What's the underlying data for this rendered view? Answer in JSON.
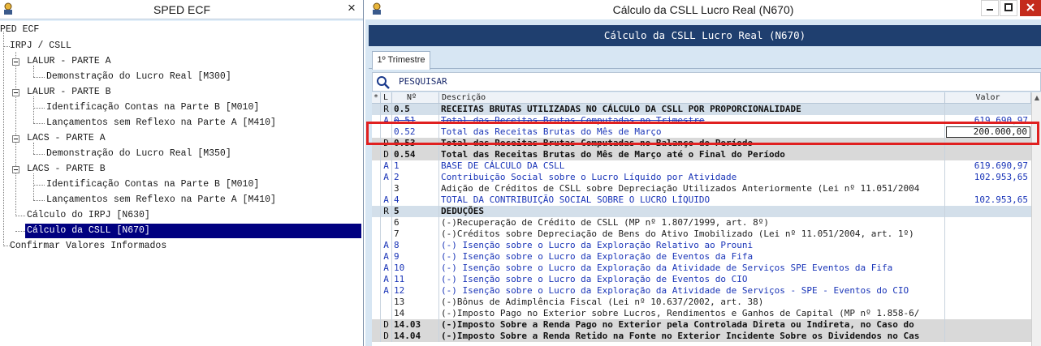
{
  "left_window": {
    "title": "SPED ECF",
    "close_label": "×",
    "tree": [
      {
        "label": "PED ECF"
      },
      {
        "label": "IRPJ / CSLL"
      },
      {
        "label": "LALUR - PARTE A"
      },
      {
        "label": "Demonstração do Lucro Real [M300]"
      },
      {
        "label": "LALUR - PARTE B"
      },
      {
        "label": "Identificação Contas na Parte B [M010]"
      },
      {
        "label": "Lançamentos sem Reflexo na Parte A [M410]"
      },
      {
        "label": "LACS - PARTE A"
      },
      {
        "label": "Demonstração do Lucro Real [M350]"
      },
      {
        "label": "LACS - PARTE B"
      },
      {
        "label": "Identificação Contas na Parte B [M010]"
      },
      {
        "label": "Lançamentos sem Reflexo na Parte A [M410]"
      },
      {
        "label": "Cálculo do IRPJ [N630]"
      },
      {
        "label": "Cálculo da CSLL [N670]"
      },
      {
        "label": "Confirmar Valores Informados"
      }
    ]
  },
  "right_window": {
    "title": "Cálculo da CSLL Lucro Real (N670)",
    "header": "Cálculo da CSLL Lucro Real (N670)",
    "tab": "1º Trimestre",
    "search_label": "PESQUISAR",
    "columns": {
      "mark": "*",
      "l": "L",
      "num": "Nº",
      "desc": "Descrição",
      "val": "Valor"
    },
    "rows": [
      {
        "l": "R",
        "num": "0.5",
        "desc": "RECEITAS BRUTAS UTILIZADAS NO CÁLCULO DA CSLL POR PROPORCIONALIDADE",
        "val": ""
      },
      {
        "l": "A",
        "num": "0.51",
        "desc": "Total das Receitas Brutas Computadas no Trimestre",
        "val": "619.690,97"
      },
      {
        "l": "",
        "num": "0.52",
        "desc": "Total das Receitas Brutas do Mês de Março",
        "val": "200.000,00"
      },
      {
        "l": "D",
        "num": "0.53",
        "desc": "Total das Receitas Brutas Computadas no Balanço do Período",
        "val": ""
      },
      {
        "l": "D",
        "num": "0.54",
        "desc": "Total das Receitas Brutas do Mês de Março até o Final do Período",
        "val": ""
      },
      {
        "l": "A",
        "num": "1",
        "desc": "BASE DE CÁLCULO DA CSLL",
        "val": "619.690,97"
      },
      {
        "l": "A",
        "num": "2",
        "desc": "Contribuição Social sobre o Lucro Líquido por Atividade",
        "val": "102.953,65"
      },
      {
        "l": "",
        "num": "3",
        "desc": "Adição de Créditos de CSLL sobre Depreciação Utilizados Anteriormente (Lei nº 11.051/2004",
        "val": ""
      },
      {
        "l": "A",
        "num": "4",
        "desc": "TOTAL DA CONTRIBUIÇÃO SOCIAL SOBRE O LUCRO LÍQUIDO",
        "val": "102.953,65"
      },
      {
        "l": "R",
        "num": "5",
        "desc": "DEDUÇÕES",
        "val": ""
      },
      {
        "l": "",
        "num": "6",
        "desc": "(-)Recuperação de Crédito de CSLL (MP nº 1.807/1999, art. 8º)",
        "val": ""
      },
      {
        "l": "",
        "num": "7",
        "desc": "(-)Créditos sobre Depreciação de Bens do Ativo Imobilizado (Lei nº 11.051/2004, art. 1º)",
        "val": ""
      },
      {
        "l": "A",
        "num": "8",
        "desc": "(-) Isenção sobre o Lucro da Exploração Relativo ao Prouni",
        "val": ""
      },
      {
        "l": "A",
        "num": "9",
        "desc": "(-) Isenção sobre o Lucro da Exploração de Eventos da Fifa",
        "val": ""
      },
      {
        "l": "A",
        "num": "10",
        "desc": "(-) Isenção sobre o Lucro da Exploração da Atividade de Serviços SPE Eventos da Fifa",
        "val": ""
      },
      {
        "l": "A",
        "num": "11",
        "desc": "(-) Isenção sobre o Lucro da Exploração de Eventos do CIO",
        "val": ""
      },
      {
        "l": "A",
        "num": "12",
        "desc": "(-) Isenção sobre o Lucro da Exploração da Atividade de Serviços - SPE - Eventos do CIO",
        "val": ""
      },
      {
        "l": "",
        "num": "13",
        "desc": "(-)Bônus de Adimplência Fiscal (Lei nº 10.637/2002, art. 38)",
        "val": ""
      },
      {
        "l": "",
        "num": "14",
        "desc": "(-)Imposto Pago no Exterior sobre Lucros, Rendimentos e Ganhos de Capital (MP nº 1.858-6/",
        "val": ""
      },
      {
        "l": "D",
        "num": "14.03",
        "desc": "(-)Imposto Sobre a Renda Pago no Exterior pela Controlada Direta ou Indireta, no Caso do",
        "val": ""
      },
      {
        "l": "D",
        "num": "14.04",
        "desc": "(-)Imposto Sobre a Renda Retido na Fonte no Exterior Incidente Sobre os Dividendos no Cas",
        "val": ""
      }
    ]
  }
}
